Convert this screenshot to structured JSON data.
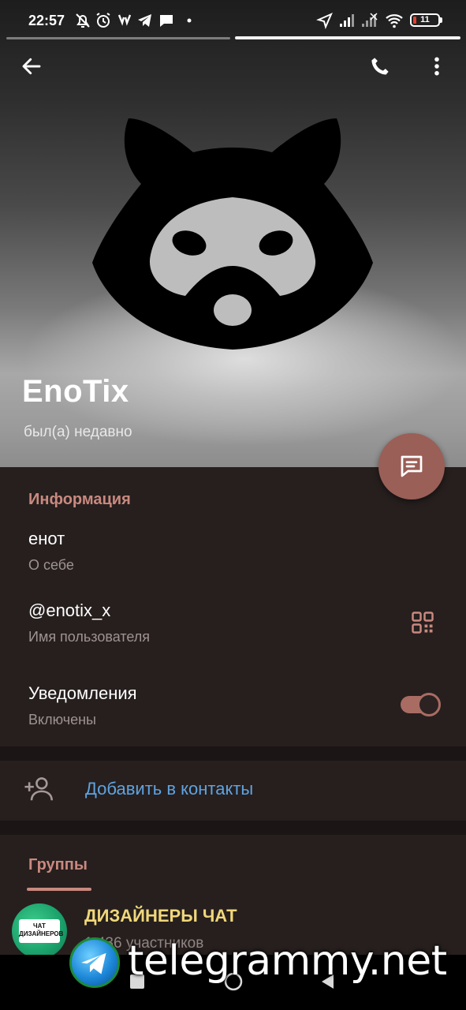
{
  "status_bar": {
    "time": "22:57",
    "battery_level": "11",
    "icons": [
      "bell-off-icon",
      "alarm-icon",
      "vk-icon",
      "telegram-icon",
      "chat-bubble-icon",
      "dot-icon",
      "location-icon",
      "signal-icon",
      "signal-no-icon",
      "wifi-icon",
      "battery-icon"
    ]
  },
  "header": {
    "back_icon": "arrow-left-icon",
    "call_icon": "phone-icon",
    "menu_icon": "more-vertical-icon"
  },
  "profile": {
    "name": "EnoTix",
    "last_seen": "был(а) недавно",
    "avatar": "raccoon-logo"
  },
  "fab": {
    "icon": "message-icon"
  },
  "info": {
    "header": "Информация",
    "bio": {
      "value": "енот",
      "label": "О себе"
    },
    "username": {
      "value": "@enotix_x",
      "label": "Имя пользователя",
      "icon": "qr-code-icon"
    },
    "notifications": {
      "value": "Уведомления",
      "label": "Включены",
      "enabled": true
    }
  },
  "actions": {
    "add_contact": {
      "label": "Добавить в контакты",
      "icon": "add-user-icon"
    }
  },
  "groups": {
    "header": "Группы",
    "items": [
      {
        "name": "ДИЗАЙНЕРЫ ЧАТ",
        "members": "1 436 участников",
        "avatar_text": "ЧАТ ДИЗАЙНЕРОВ"
      }
    ]
  },
  "watermark": {
    "text": "telegrammy.net"
  },
  "colors": {
    "accent": "#c9897f",
    "fab": "#9a5f57",
    "link": "#5fa3e0",
    "group_name": "#f0d77a",
    "panel": "#261f1e"
  }
}
